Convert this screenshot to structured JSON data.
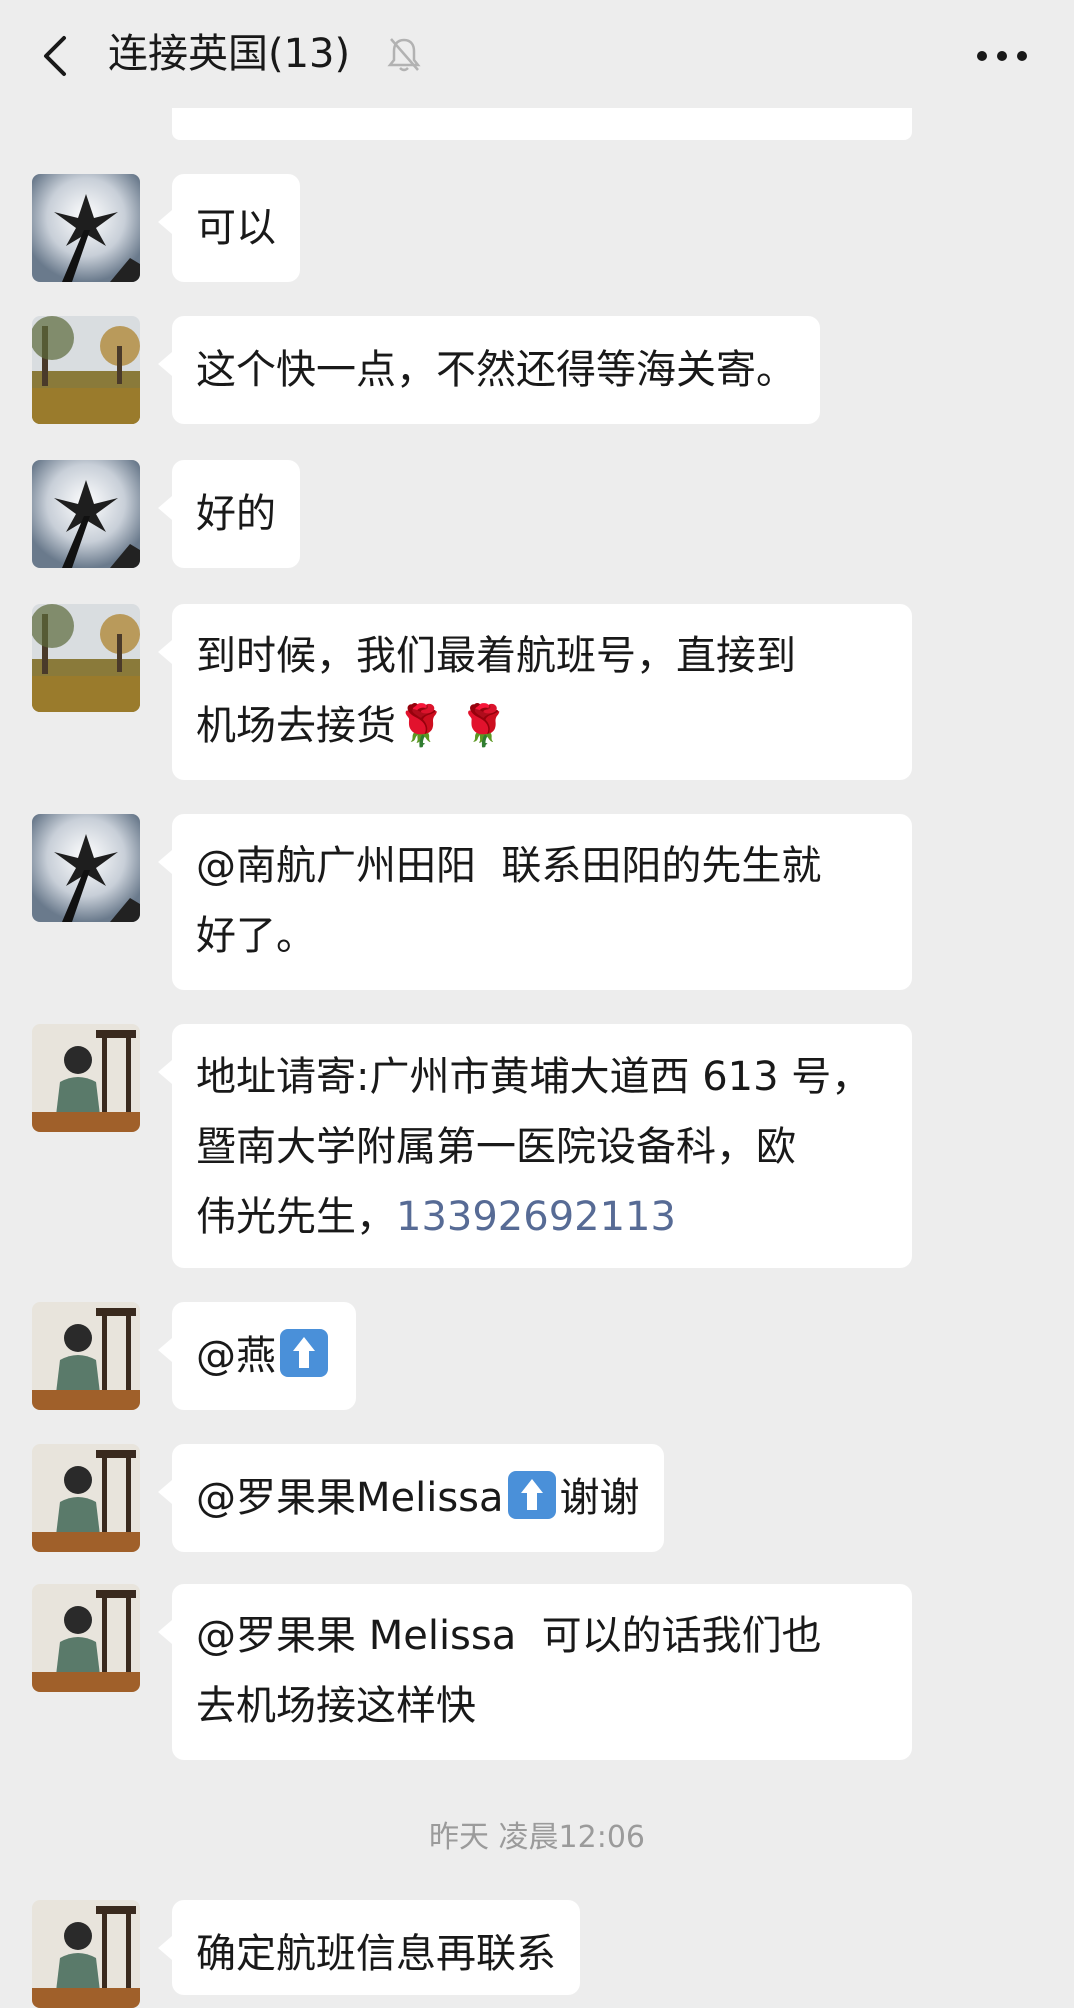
{
  "header": {
    "title": "连接英国(13)",
    "back_icon": "chevron-left-icon",
    "mute_icon": "bell-off-icon",
    "more_icon": "more-dots-icon"
  },
  "messages": [
    {
      "text": "可以",
      "avatar": "avatar-lily-sculpture"
    },
    {
      "text": "这个快一点，不然还得等海关寄。",
      "avatar": "avatar-autumn-park"
    },
    {
      "text": "好的",
      "avatar": "avatar-lily-sculpture"
    },
    {
      "text_line1": "到时候，我们最着航班号，直接到",
      "text_line2": "机场去接货",
      "emoji": "🌹 🌹",
      "avatar": "avatar-autumn-park"
    },
    {
      "text": "@南航广州田阳  联系田阳的先生就\n好了。",
      "avatar": "avatar-lily-sculpture"
    },
    {
      "text": "地址请寄:广州市黄埔大道西 613 号，\n暨南大学附属第一医院设备科，欧\n伟光先生，",
      "phone": "13392692113",
      "avatar": "avatar-woman-pavilion"
    },
    {
      "text": "@燕",
      "emoji_icon": "up-arrow-emoji-icon",
      "avatar": "avatar-woman-pavilion"
    },
    {
      "text_prefix": "@罗果果Melissa",
      "text_suffix": "谢谢",
      "emoji_icon": "up-arrow-emoji-icon",
      "avatar": "avatar-woman-pavilion"
    },
    {
      "text": "@罗果果 Melissa  可以的话我们也\n去机场接这样快",
      "avatar": "avatar-woman-pavilion"
    },
    {
      "text": "确定航班信息再联系",
      "avatar": "avatar-woman-pavilion"
    }
  ],
  "timestamp": "昨天 凌晨12:06",
  "colors": {
    "background": "#ededed",
    "bubble": "#ffffff",
    "link": "#576b95"
  }
}
